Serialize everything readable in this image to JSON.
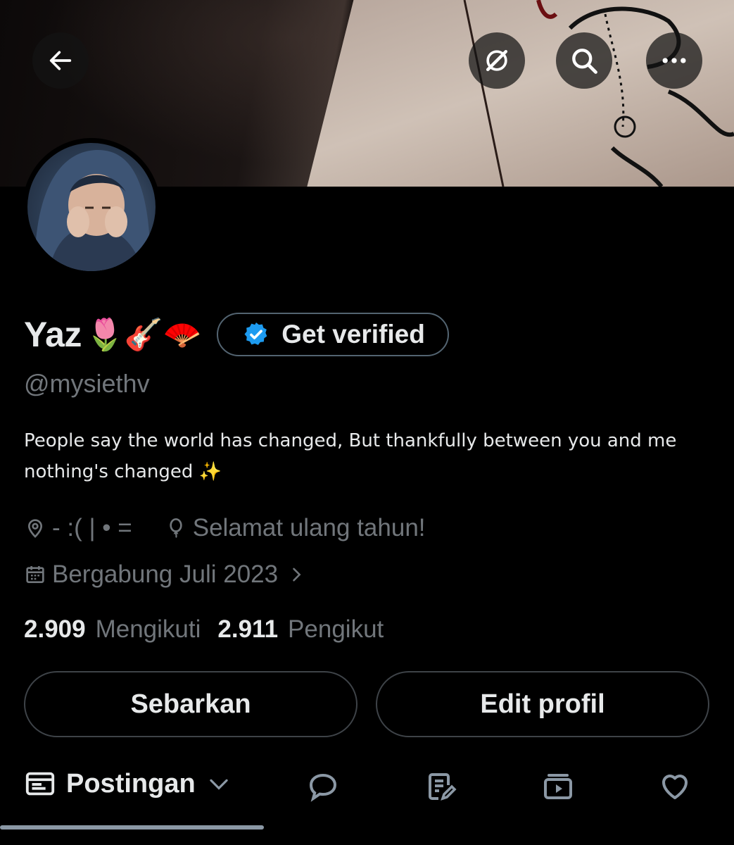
{
  "header": {
    "back_icon": "arrow-left-icon",
    "actions": [
      "grok-icon",
      "search-icon",
      "more-icon"
    ]
  },
  "profile": {
    "name": "Yaz",
    "name_emojis": "🌷🎸🪭",
    "verify_label": "Get verified",
    "handle": "@mysiethv",
    "bio": "People say the world has changed, But thankfully between you and me nothing's changed ✨",
    "location": "- :( | • =",
    "birthday": "Selamat ulang tahun!",
    "joined": "Bergabung Juli 2023",
    "following_count": "2.909",
    "following_label": "Mengikuti",
    "followers_count": "2.911",
    "followers_label": "Pengikut"
  },
  "buttons": {
    "share": "Sebarkan",
    "edit": "Edit profil"
  },
  "tabs": {
    "active": "Postingan",
    "icons": [
      "reply-icon",
      "article-icon",
      "media-icon",
      "likes-icon"
    ]
  },
  "colors": {
    "background": "#000000",
    "text": "#e7e9ea",
    "muted": "#71767b",
    "verified": "#1d9bf0",
    "border": "#3e4348"
  }
}
